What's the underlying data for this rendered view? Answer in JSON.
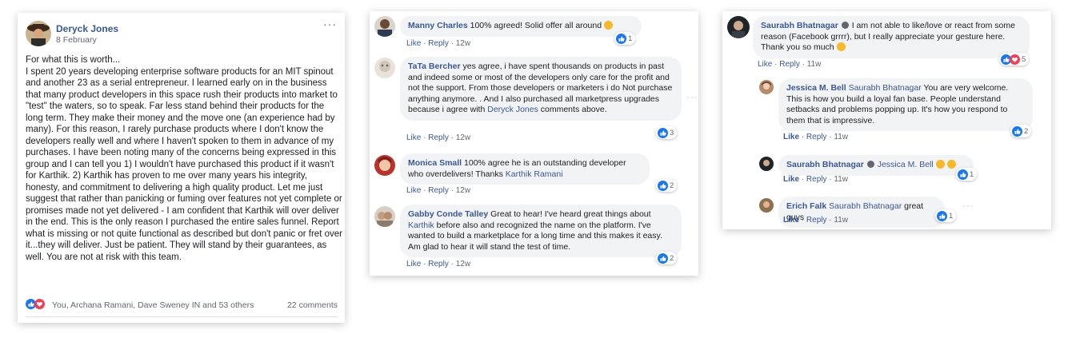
{
  "post": {
    "author": "Deryck Jones",
    "date": "8 February",
    "body": "For what this is worth...\nI spent 20 years developing enterprise software products for an MIT spinout and another 23 as a serial entrepreneur. I learned early on in the business that many product developers in this space rush their products into market to \"test\" the waters, so to speak. Far less stand behind their products for the long term. They make their money and the move one (an experience had by many). For this reason, I rarely purchase products where I don't know the developers really well and where I haven't spoken to them in advance of my purchases. I have been noting many of the concerns being expressed in this group and I can tell you 1) I wouldn't have purchased this product if it wasn't for Karthik. 2) Karthik has proven to me over many years his integrity, honesty, and commitment to delivering a high quality product. Let me just suggest that rather than panicking or fuming over features not yet complete or promises made not yet delivered - I am confident that Karthik will over deliver in the end. This is the only reason I purchased the entire sales funnel. Report what is missing or not quite functional as described but don't panic or fret over it...they will deliver. Just be patient. They will stand by their guarantees, as well. You are not at risk with this team.",
    "reactions_text": "You, Archana Ramani, Dave Sweney IN and 53 others",
    "comments_count": "22 comments",
    "more": "···"
  },
  "actions": {
    "like": "Like",
    "reply": "Reply",
    "sep": " · "
  },
  "comments_mid": [
    {
      "name": "Manny Charles",
      "text": " 100% agreed! Solid offer all around ",
      "time": "12w",
      "count": "1"
    },
    {
      "name": "TaTa Bercher",
      "text": " yes agree, i have spent thousands on products in past and indeed some or most of the developers only care for the profit and not the support. From those developers or marketers i do Not purchase anything anymore. . And I also purchased all marketpress upgrades because i agree with ",
      "link": "Deryck Jones",
      "text2": " comments above.",
      "time": "12w",
      "count": "3"
    },
    {
      "name": "Monica Small",
      "text": " 100% agree he is an outstanding developer who overdelivers! Thanks ",
      "link": "Karthik Ramani",
      "time": "12w",
      "count": "2"
    },
    {
      "name": "Gabby Conde Talley",
      "text": " Great to hear! I've heard great things about ",
      "link": "Karthik",
      "text2": " before also and recognized the name on the platform. I've wanted to build a marketplace for a long time and this makes it easy. Am glad to hear it will stand the test of time.",
      "time": "12w",
      "count": "2"
    }
  ],
  "comments_right": [
    {
      "name": "Saurabh Bhatnagar",
      "text": " I am not able to like/love or react from some reason (Facebook grrrr), but I really appreciate your gesture here. Thank you so much ",
      "time": "11w",
      "count": "5"
    },
    {
      "name": "Jessica M. Bell",
      "mention": "Saurabh Bhatnagar",
      "text": " You are very welcome. This is how you build a loyal fan base. People understand setbacks and problems popping up. It's how you respond to them that is impressive.",
      "time": "11w",
      "count": "2"
    },
    {
      "name": "Saurabh Bhatnagar",
      "mention": "Jessica M. Bell",
      "text": "",
      "time": "11w",
      "count": "1"
    },
    {
      "name": "Erich Falk",
      "mention": "Saurabh Bhatnagar",
      "text": " great guys",
      "time": "11w",
      "count": "1"
    }
  ],
  "colors": {
    "link": "#385898",
    "bubble": "#f2f3f5",
    "like_blue": "#1877f2",
    "love_red": "#f33e58"
  }
}
